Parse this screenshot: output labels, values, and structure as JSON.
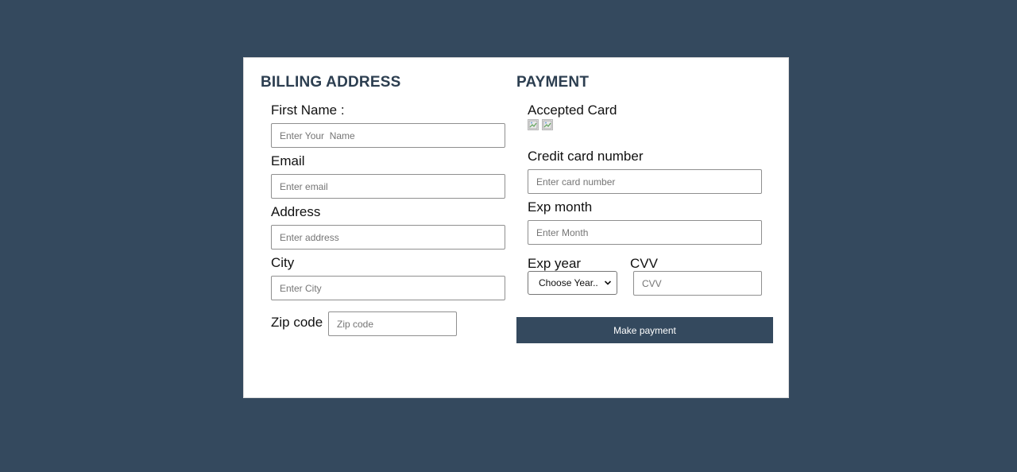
{
  "billing": {
    "heading": "BILLING ADDRESS",
    "first_name": {
      "label": "First Name :",
      "placeholder": "Enter Your  Name"
    },
    "email": {
      "label": "Email",
      "placeholder": "Enter email"
    },
    "address": {
      "label": "Address",
      "placeholder": "Enter address"
    },
    "city": {
      "label": "City",
      "placeholder": "Enter City"
    },
    "zip": {
      "label": "Zip code",
      "placeholder": "Zip code"
    }
  },
  "payment": {
    "heading": "PAYMENT",
    "accepted_card": {
      "label": "Accepted Card",
      "images": [
        "broken-image-icon",
        "broken-image-icon"
      ]
    },
    "card_number": {
      "label": "Credit card number",
      "placeholder": "Enter card number"
    },
    "exp_month": {
      "label": "Exp month",
      "placeholder": "Enter Month"
    },
    "exp_year": {
      "label": "Exp year",
      "selected": "Choose Year.."
    },
    "cvv": {
      "label": "CVV",
      "placeholder": "CVV"
    },
    "submit_label": "Make payment"
  },
  "colors": {
    "page_background": "#34495e",
    "heading": "#2c3e50",
    "button_background": "#34495e",
    "button_text": "#ffffff"
  }
}
